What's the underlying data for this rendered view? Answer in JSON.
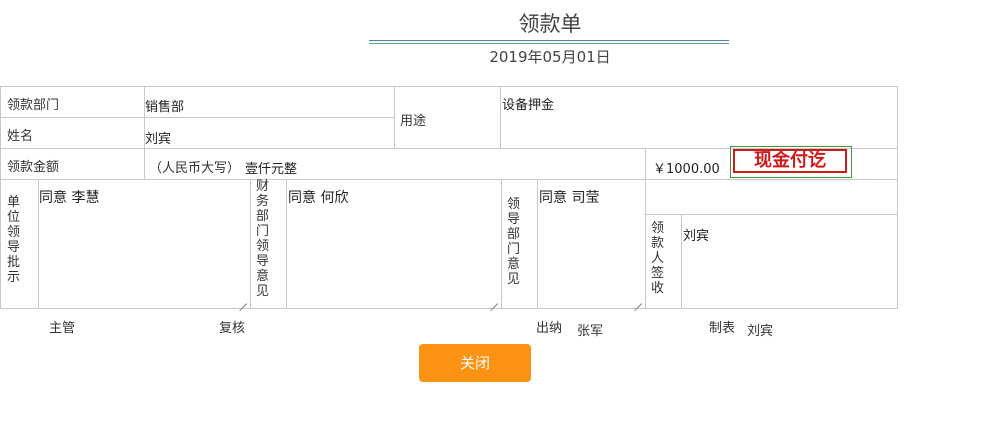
{
  "header": {
    "title": "领款单",
    "date": "2019年05月01日"
  },
  "form": {
    "department_label": "领款部门",
    "department_value": "销售部",
    "name_label": "姓名",
    "name_value": "刘宾",
    "purpose_label": "用途",
    "purpose_value": "设备押金",
    "amount_label": "领款金额",
    "amount_caps_label": "（人民币大写）",
    "amount_caps_value": "壹仟元整",
    "amount_value": "￥1000.00",
    "stamp_text": "现金付讫",
    "unit_leader_label": "单位领导批示",
    "unit_leader_opinion": "同意    李慧",
    "finance_leader_label": "财务部门领导意见",
    "finance_leader_opinion": "同意    何欣",
    "dept_leader_label": "领导部门意见",
    "dept_leader_opinion": "同意    司莹",
    "receiver_label": "领款人签收",
    "receiver_value": "刘宾"
  },
  "footer": {
    "supervisor_label": "主管",
    "reviewer_label": "复核",
    "cashier_label": "出纳",
    "cashier_value": "张军",
    "preparer_label": "制表",
    "preparer_value": "刘宾"
  },
  "actions": {
    "close_label": "关闭"
  },
  "colors": {
    "accent_button": "#fb9214",
    "stamp_red": "#d0191b",
    "border": "#c8c8c8"
  }
}
